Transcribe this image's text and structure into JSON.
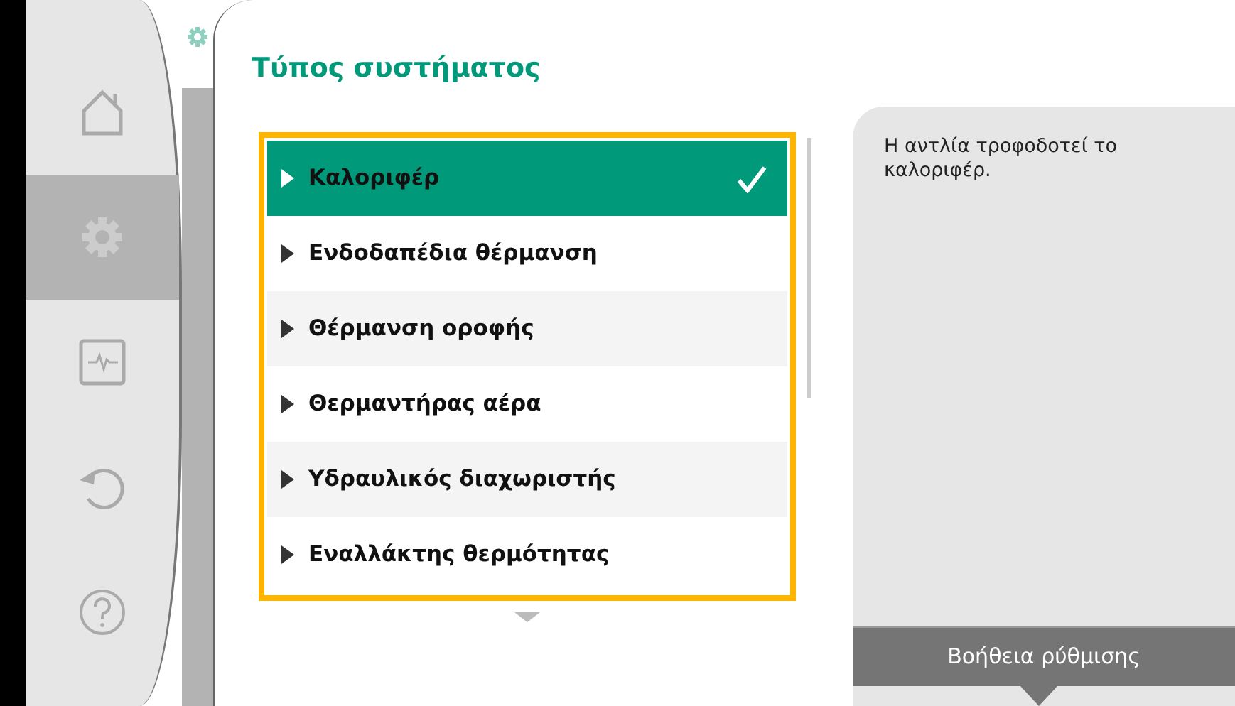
{
  "sidebar": {
    "items": [
      {
        "selected": false
      },
      {
        "selected": true
      },
      {
        "selected": false
      },
      {
        "selected": false
      },
      {
        "selected": false
      }
    ]
  },
  "title": "Τύπος συστήματος",
  "options": [
    {
      "label": "Καλοριφέρ",
      "selected": true
    },
    {
      "label": "Ενδοδαπέδια θέρμανση",
      "selected": false
    },
    {
      "label": "Θέρμανση οροφής",
      "selected": false
    },
    {
      "label": "Θερμαντήρας αέρα",
      "selected": false
    },
    {
      "label": "Υδραυλικός διαχωριστής",
      "selected": false
    },
    {
      "label": "Εναλλάκτης θερμότητας",
      "selected": false
    }
  ],
  "help": {
    "text": "Η αντλία τροφοδοτεί το καλοριφέρ.",
    "button": "Βοήθεια ρύθμισης"
  }
}
